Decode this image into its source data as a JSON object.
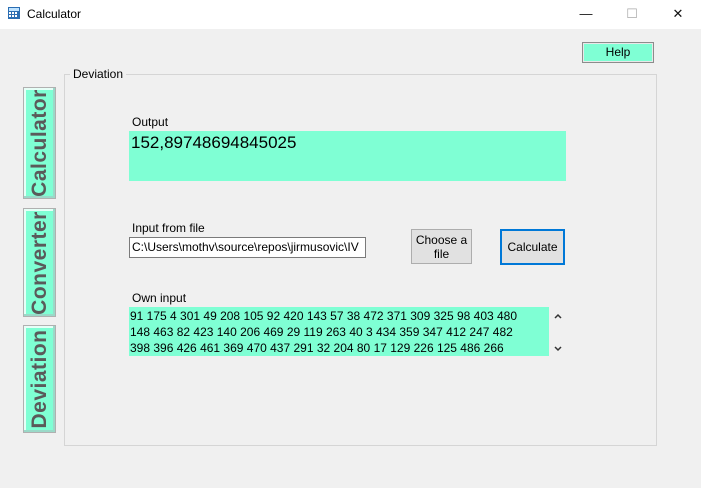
{
  "window": {
    "title": "Calculator",
    "minimize_glyph": "—",
    "maximize_glyph": "☐",
    "close_glyph": "✕"
  },
  "help_button": {
    "label": "Help"
  },
  "side_tabs": [
    {
      "label": "Calculator"
    },
    {
      "label": "Converter"
    },
    {
      "label": "Deviation"
    }
  ],
  "deviation": {
    "group_title": "Deviation",
    "output_label": "Output",
    "output_value": "152,89748694845025",
    "input_file_label": "Input from file",
    "file_path": "C:\\Users\\mothv\\source\\repos\\jirmusovic\\IV",
    "choose_file_label_line1": "Choose a",
    "choose_file_label_line2": "file",
    "calculate_label": "Calculate",
    "own_input_label": "Own input",
    "own_input_lines": [
      "91 175 4 301 49 208 105 92 420 143 57 38 472 371 309 325 98 403 480",
      "148 463 82 423 140 206 469 29 119 263 40 3 434 359 347 412 247 482",
      "398 396 426 461 369 470 437 291 32 204 80 17 129 226 125 486 266"
    ]
  },
  "colors": {
    "accent": "#7fffd4",
    "focus_border": "#0078d7",
    "background": "#f0f0f0"
  },
  "icons": {
    "app": "calculator-icon",
    "scroll_up": "chevron-up-icon",
    "scroll_down": "chevron-down-icon"
  }
}
